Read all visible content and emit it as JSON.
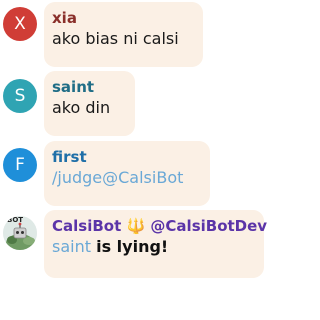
{
  "messages": [
    {
      "initial": "X",
      "avatar_color": "#d03d36",
      "name": "xia",
      "name_color": "#8a2f2a",
      "text": "ako bias ni calsi"
    },
    {
      "initial": "S",
      "avatar_color": "#2fa4b3",
      "name": "saint",
      "name_color": "#1f6d86",
      "text": "ako din"
    },
    {
      "initial": "F",
      "avatar_color": "#1f8fd9",
      "name": "first",
      "name_color": "#1f6fa8",
      "text": "/judge@CalsiBot"
    },
    {
      "avatar_label": "BOT",
      "name": "CalsiBot",
      "name_color": "#5b34a8",
      "badge_emoji": "🔱",
      "handle": "@CalsiBotDev",
      "text_mention": "saint",
      "text_rest": "is lying!"
    }
  ]
}
